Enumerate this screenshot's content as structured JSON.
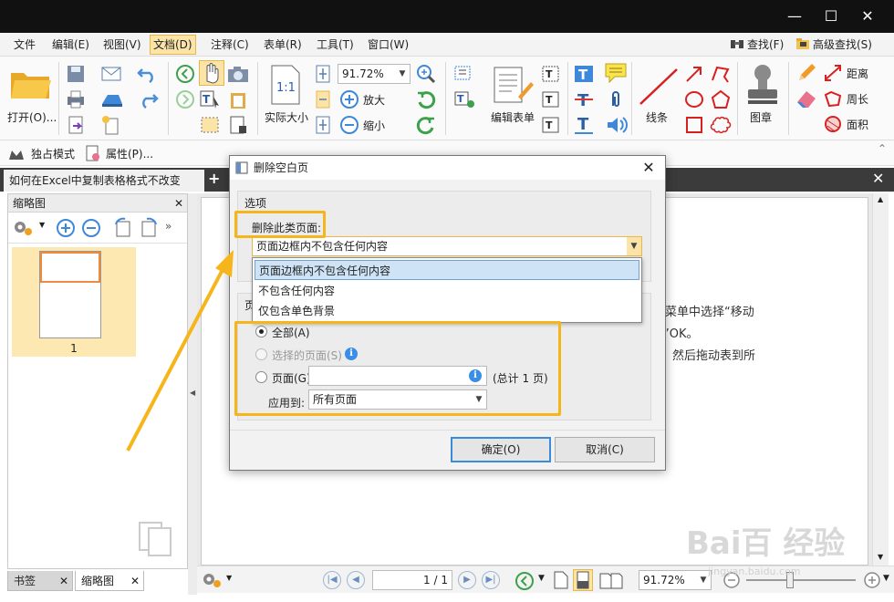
{
  "menubar": {
    "items": [
      "文件",
      "编辑(E)",
      "视图(V)",
      "文档(D)",
      "注释(C)",
      "表单(R)",
      "工具(T)",
      "窗口(W)"
    ],
    "find_label": "查找(F)",
    "advanced_find_label": "高级查找(S)"
  },
  "toolbar": {
    "open_label": "打开(O)...",
    "zoom_value": "91.72%",
    "actual_size_label": "实际大小",
    "actual_size_icon_text": "1:1",
    "zoom_in_label": "放大",
    "zoom_out_label": "缩小",
    "edit_form_label": "编辑表单",
    "line_label": "线条",
    "stamp_label": "图章",
    "distance_label": "距离",
    "perimeter_label": "周长",
    "area_label": "面积",
    "exclusive_mode_label": "独占模式",
    "properties_label": "属性(P)..."
  },
  "tabs": {
    "document_tab": "如何在Excel中复制表格格式不改变"
  },
  "left_panel": {
    "title": "缩略图",
    "page_number": "1",
    "bottom_tab_bookmarks": "书签",
    "bottom_tab_thumbnails": "缩略图"
  },
  "document": {
    "line1": "菜单中选择“移动",
    "line2": "”OK。",
    "line3": "然后拖动表到所"
  },
  "dialog": {
    "title": "删除空白页",
    "options_group": "选项",
    "delete_type_label": "删除此类页面:",
    "delete_type_value": "页面边框内不包含任何内容",
    "dropdown_options": [
      "页面边框内不包含任何内容",
      "不包含任何内容",
      "仅包含单色背景"
    ],
    "range_group_fragment": "页",
    "radio_all": "全部(A)",
    "radio_selected": "选择的页面(S)",
    "radio_pages": "页面(G)",
    "pages_total": "(总计 1 页)",
    "apply_to_label": "应用到:",
    "apply_to_value": "所有页面",
    "ok_button": "确定(O)",
    "cancel_button": "取消(C)"
  },
  "statusbar": {
    "page_indicator": "1 / 1",
    "zoom_value": "91.72%"
  },
  "watermark": {
    "text": "Bai百 经验",
    "url": "jingyan.baidu.com"
  },
  "colors": {
    "annotation": "#f7b51c",
    "active_menu": "#fce4a8",
    "selection_blue": "#cfe3f7"
  }
}
